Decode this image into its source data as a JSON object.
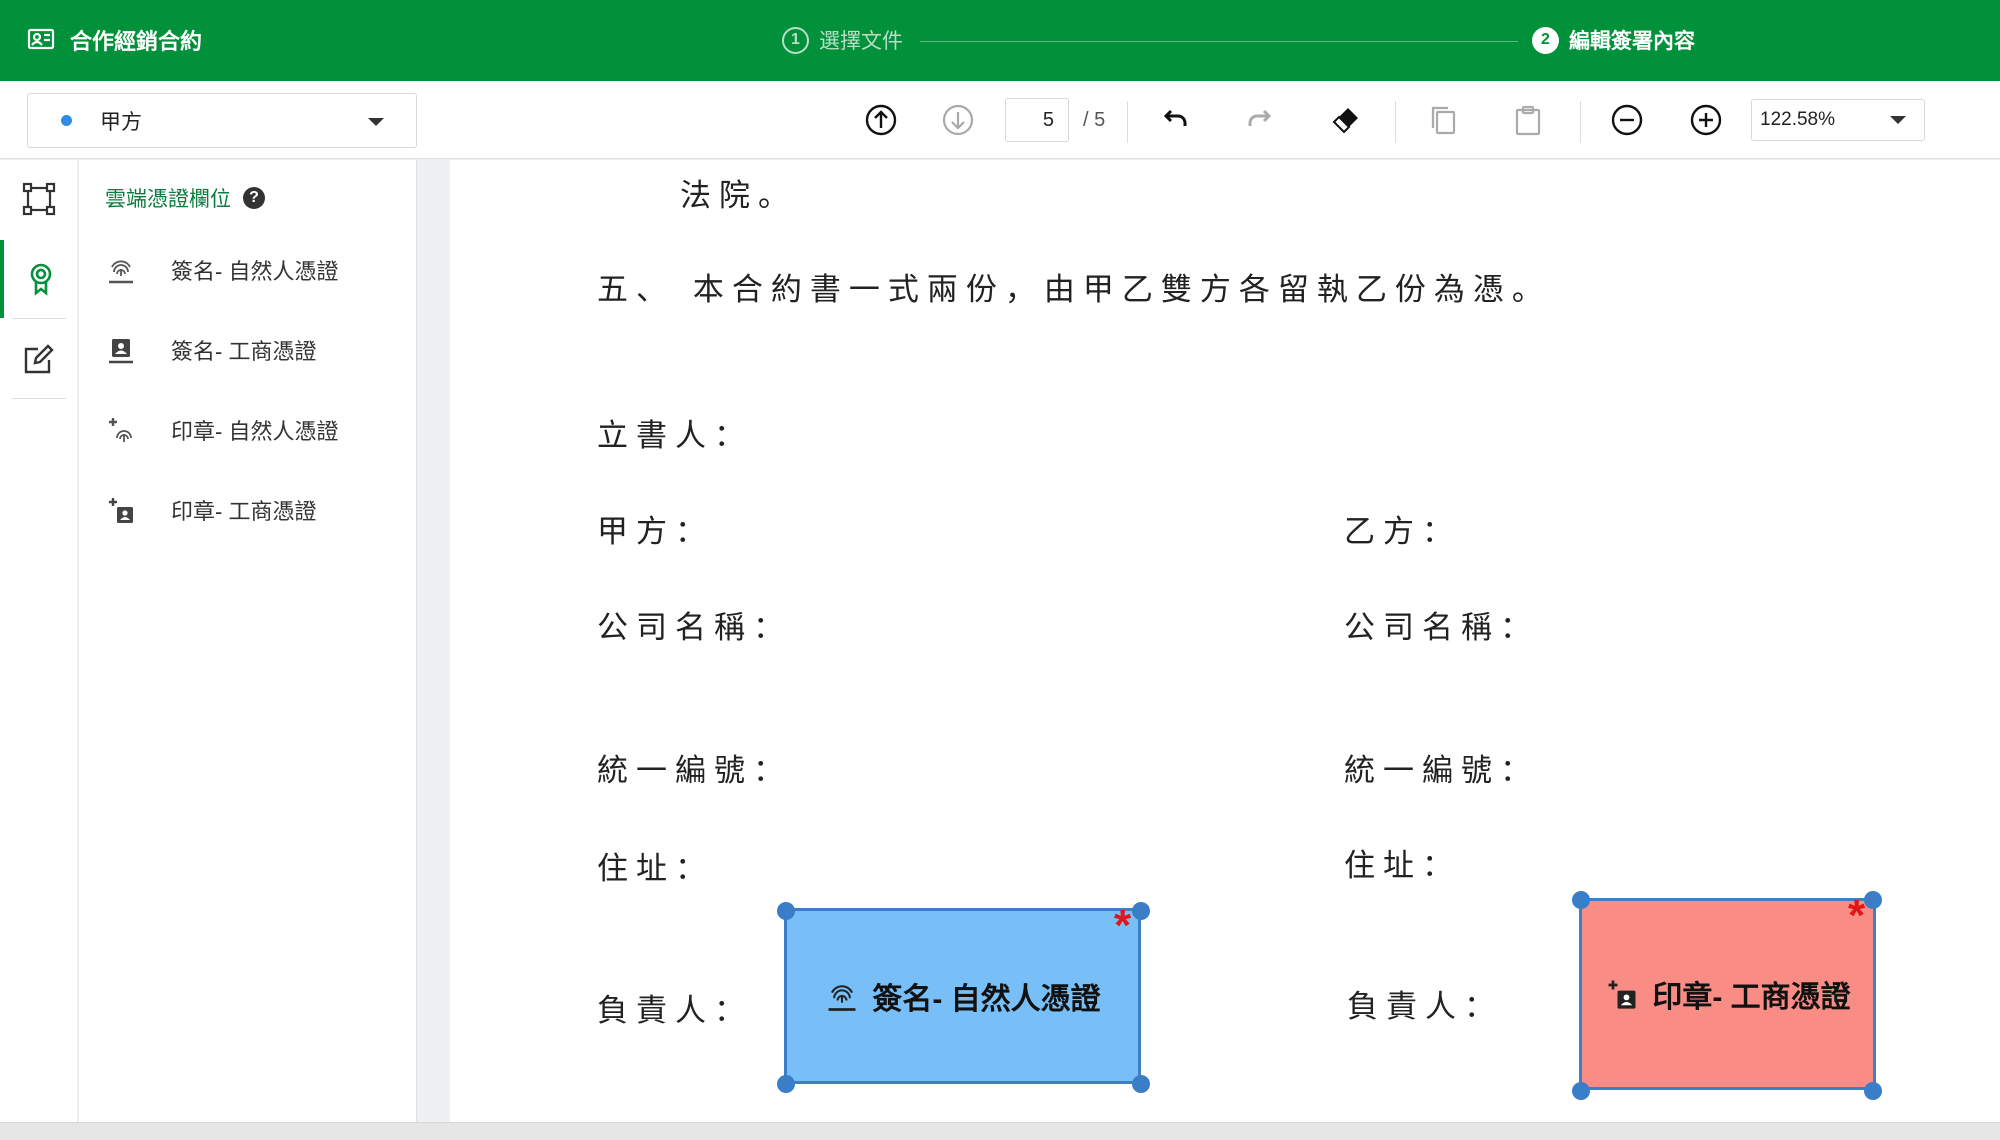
{
  "header": {
    "app_title": "合作經銷合約",
    "steps": [
      {
        "num": "1",
        "label": "選擇文件"
      },
      {
        "num": "2",
        "label": "編輯簽署內容"
      }
    ]
  },
  "toolbar": {
    "party_selected": "甲方",
    "page_current": "5",
    "page_total": "/ 5",
    "zoom": "122.58%"
  },
  "panel": {
    "title": "雲端憑證欄位",
    "help": "?",
    "items": [
      {
        "label": "簽名- 自然人憑證",
        "icon": "fingerprint-sign-icon"
      },
      {
        "label": "簽名- 工商憑證",
        "icon": "badge-sign-icon"
      },
      {
        "label": "印章- 自然人憑證",
        "icon": "fingerprint-stamp-icon"
      },
      {
        "label": "印章- 工商憑證",
        "icon": "badge-stamp-icon"
      }
    ]
  },
  "document": {
    "line_court": "法院。",
    "line_five": "五、 本合約書一式兩份，由甲乙雙方各留執乙份為憑。",
    "signatory": "立書人：",
    "party_a": "甲方：",
    "party_b": "乙方：",
    "company_name": "公司名稱：",
    "tax_id": "統一編號：",
    "address": "住址：",
    "responsible": "負責人："
  },
  "fields": {
    "blue_label": "簽名- 自然人憑證",
    "red_label": "印章- 工商憑證",
    "required_mark": "*"
  },
  "colors": {
    "brand": "#00913a",
    "signature_field": "#78bff7",
    "stamp_field": "#f98d86",
    "handle": "#3a7ec7",
    "required": "#e0161a"
  }
}
